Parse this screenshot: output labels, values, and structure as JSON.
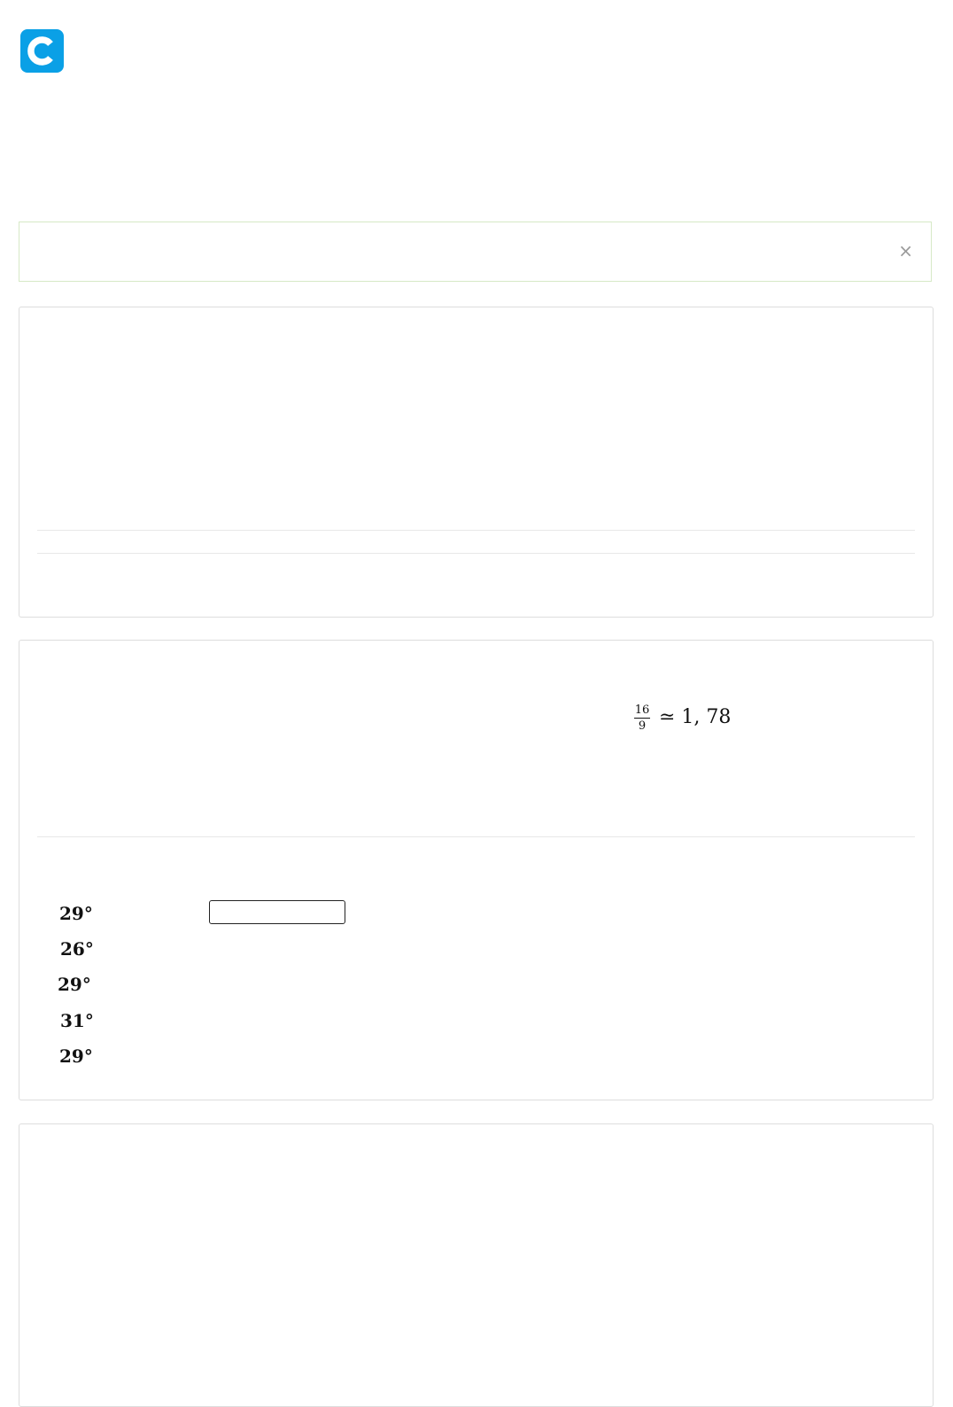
{
  "header": {
    "logo_icon": "c-logo-icon",
    "logo_color": "#0aa0e6"
  },
  "alert": {
    "close_label": "×",
    "border_color": "#d6e9c6"
  },
  "section2": {
    "fraction_numerator": "16",
    "fraction_denominator": "9",
    "approx_text": "≃ 1, 78",
    "temperatures": [
      "29°",
      "26°",
      "29°",
      "31°",
      "29°"
    ],
    "answer_input": {
      "value": "",
      "placeholder": ""
    }
  }
}
